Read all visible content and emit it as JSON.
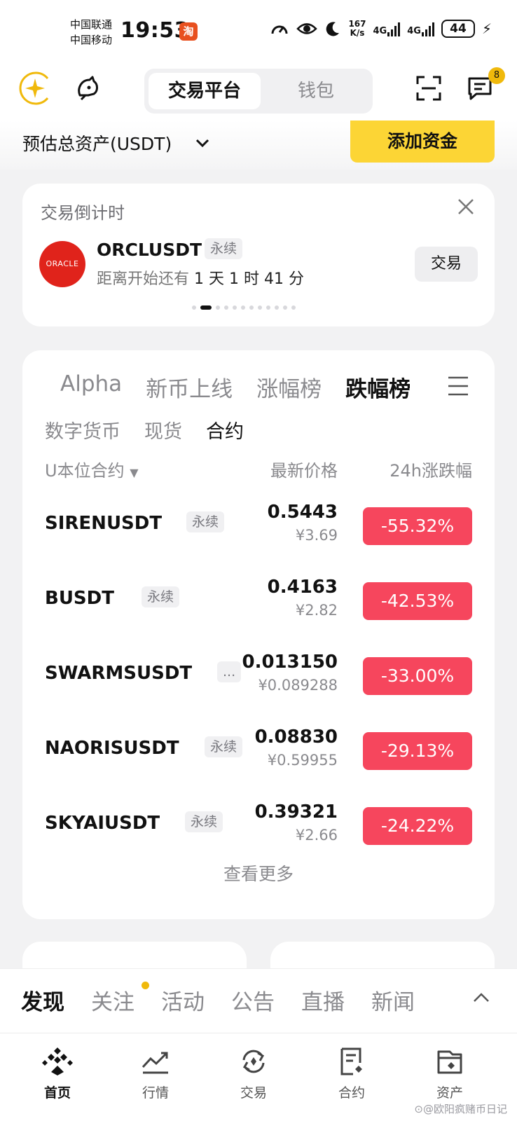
{
  "status_bar": {
    "carrier1": "中国联通",
    "carrier2": "中国移动",
    "time": "19:53",
    "app_icon_text": "淘",
    "speed_value": "167",
    "speed_unit": "K/s",
    "signal1": "4G",
    "signal2": "4G",
    "battery": "44"
  },
  "topnav": {
    "tab_active": "交易平台",
    "tab_inactive": "钱包",
    "notification_count": "8"
  },
  "assets": {
    "label": "预估总资产(USDT)",
    "add_funds": "添加资金"
  },
  "countdown": {
    "title": "交易倒计时",
    "logo_text": "ORACLE",
    "symbol": "ORCLUSDT",
    "tag": "永续",
    "time_prefix": "距离开始还有",
    "days": "1",
    "days_unit": "天",
    "hours": "1",
    "hours_unit": "时",
    "minutes": "41",
    "minutes_unit": "分",
    "trade_button": "交易",
    "carousel_total": 12,
    "carousel_active": 1
  },
  "market": {
    "tabs": [
      "Alpha",
      "新币上线",
      "涨幅榜",
      "跌幅榜"
    ],
    "active_tab": "跌幅榜",
    "sub_tabs": [
      "数字货币",
      "现货",
      "合约"
    ],
    "active_sub_tab": "合约",
    "columns": {
      "pair": "U本位合约",
      "price": "最新价格",
      "change": "24h涨跌幅"
    },
    "rows": [
      {
        "symbol": "SIRENUSDT",
        "tag": "永续",
        "price": "0.5443",
        "cny": "¥3.69",
        "change": "-55.32%"
      },
      {
        "symbol": "BUSDT",
        "tag": "永续",
        "price": "0.4163",
        "cny": "¥2.82",
        "change": "-42.53%"
      },
      {
        "symbol": "SWARMSUSDT",
        "tag": "...",
        "price": "0.013150",
        "cny": "¥0.089288",
        "change": "-33.00%"
      },
      {
        "symbol": "NAORISUSDT",
        "tag": "永续",
        "price": "0.08830",
        "cny": "¥0.59955",
        "change": "-29.13%"
      },
      {
        "symbol": "SKYAIUSDT",
        "tag": "永续",
        "price": "0.39321",
        "cny": "¥2.66",
        "change": "-24.22%"
      }
    ],
    "more": "查看更多",
    "down_color": "#f6465d"
  },
  "feed": {
    "tabs": [
      "发现",
      "关注",
      "活动",
      "公告",
      "直播",
      "新闻"
    ],
    "active_tab": "发现"
  },
  "bottom_nav": [
    {
      "label": "首页",
      "icon": "home-icon"
    },
    {
      "label": "行情",
      "icon": "markets-icon"
    },
    {
      "label": "交易",
      "icon": "trade-icon"
    },
    {
      "label": "合约",
      "icon": "futures-icon"
    },
    {
      "label": "资产",
      "icon": "wallet-icon"
    }
  ],
  "watermark": "欧阳疯赌币日记",
  "accent_color": "#fcd535"
}
